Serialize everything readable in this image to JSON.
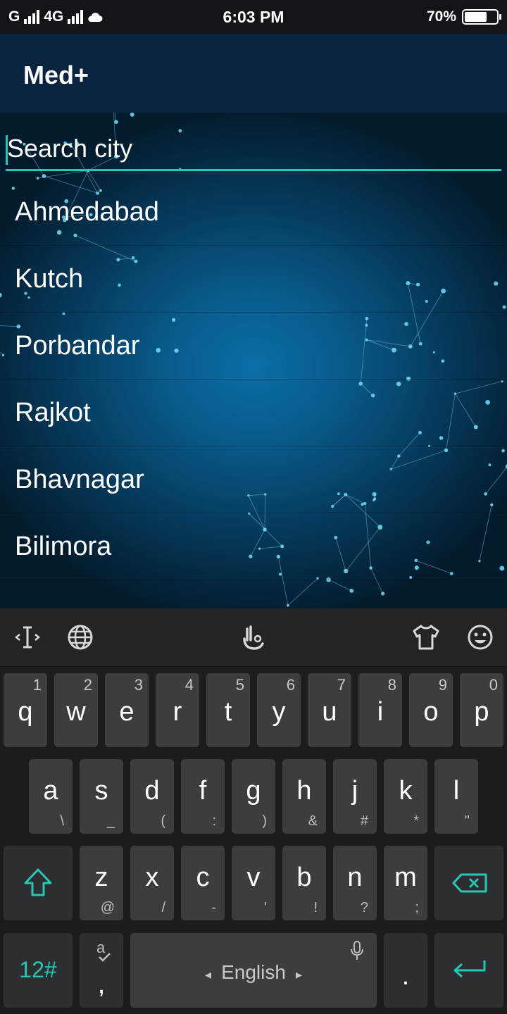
{
  "status": {
    "left": "G",
    "network": "4G",
    "time": "6:03 PM",
    "battery": "70%",
    "battery_level": 0.7
  },
  "app": {
    "title": "Med+"
  },
  "search": {
    "placeholder": "Search city"
  },
  "cities": [
    "Ahmedabad",
    "Kutch",
    "Porbandar",
    "Rajkot",
    "Bhavnagar",
    "Bilimora"
  ],
  "keyboard": {
    "row1": [
      {
        "k": "q",
        "n": "1"
      },
      {
        "k": "w",
        "n": "2"
      },
      {
        "k": "e",
        "n": "3"
      },
      {
        "k": "r",
        "n": "4"
      },
      {
        "k": "t",
        "n": "5"
      },
      {
        "k": "y",
        "n": "6"
      },
      {
        "k": "u",
        "n": "7"
      },
      {
        "k": "i",
        "n": "8"
      },
      {
        "k": "o",
        "n": "9"
      },
      {
        "k": "p",
        "n": "0"
      }
    ],
    "row2": [
      {
        "k": "a",
        "s": "\\"
      },
      {
        "k": "s",
        "s": "_"
      },
      {
        "k": "d",
        "s": "("
      },
      {
        "k": "f",
        "s": ":"
      },
      {
        "k": "g",
        "s": ")"
      },
      {
        "k": "h",
        "s": "&"
      },
      {
        "k": "j",
        "s": "#"
      },
      {
        "k": "k",
        "s": "*"
      },
      {
        "k": "l",
        "s": "\""
      }
    ],
    "row3": [
      {
        "k": "z",
        "s": "@"
      },
      {
        "k": "x",
        "s": "/"
      },
      {
        "k": "c",
        "s": "-"
      },
      {
        "k": "v",
        "s": "'"
      },
      {
        "k": "b",
        "s": "!"
      },
      {
        "k": "n",
        "s": "?"
      },
      {
        "k": "m",
        "s": ";"
      }
    ],
    "symbols_label": "12#",
    "comma": ",",
    "space_label": "English",
    "period": "."
  }
}
